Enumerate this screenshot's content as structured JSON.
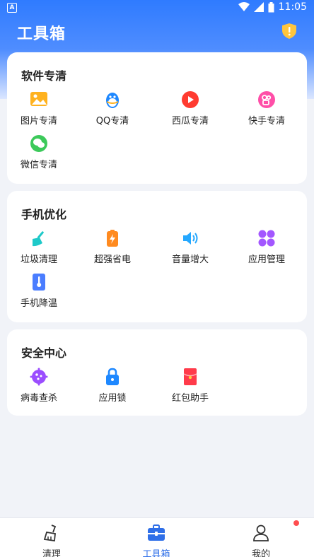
{
  "status_bar": {
    "time": "11:05",
    "app_badge": "A"
  },
  "header": {
    "title": "工具箱"
  },
  "colors": {
    "accent": "#2f6fe8",
    "header_top": "#2f7bff"
  },
  "sections": [
    {
      "title": "软件专清",
      "items": [
        {
          "label": "图片专清",
          "icon": "image-icon"
        },
        {
          "label": "QQ专清",
          "icon": "qq-penguin-icon"
        },
        {
          "label": "西瓜专清",
          "icon": "play-icon"
        },
        {
          "label": "快手专清",
          "icon": "kuaishou-icon"
        },
        {
          "label": "微信专清",
          "icon": "wechat-icon"
        }
      ]
    },
    {
      "title": "手机优化",
      "items": [
        {
          "label": "垃圾清理",
          "icon": "broom-icon"
        },
        {
          "label": "超强省电",
          "icon": "battery-icon"
        },
        {
          "label": "音量增大",
          "icon": "speaker-icon"
        },
        {
          "label": "应用管理",
          "icon": "apps-grid-icon"
        },
        {
          "label": "手机降温",
          "icon": "thermometer-icon"
        }
      ]
    },
    {
      "title": "安全中心",
      "items": [
        {
          "label": "病毒查杀",
          "icon": "virus-icon"
        },
        {
          "label": "应用锁",
          "icon": "lock-icon"
        },
        {
          "label": "红包助手",
          "icon": "red-envelope-icon"
        }
      ]
    }
  ],
  "bottom_nav": [
    {
      "label": "清理",
      "icon": "broom-icon",
      "active": false
    },
    {
      "label": "工具箱",
      "icon": "toolbox-icon",
      "active": true
    },
    {
      "label": "我的",
      "icon": "user-icon",
      "active": false
    }
  ]
}
